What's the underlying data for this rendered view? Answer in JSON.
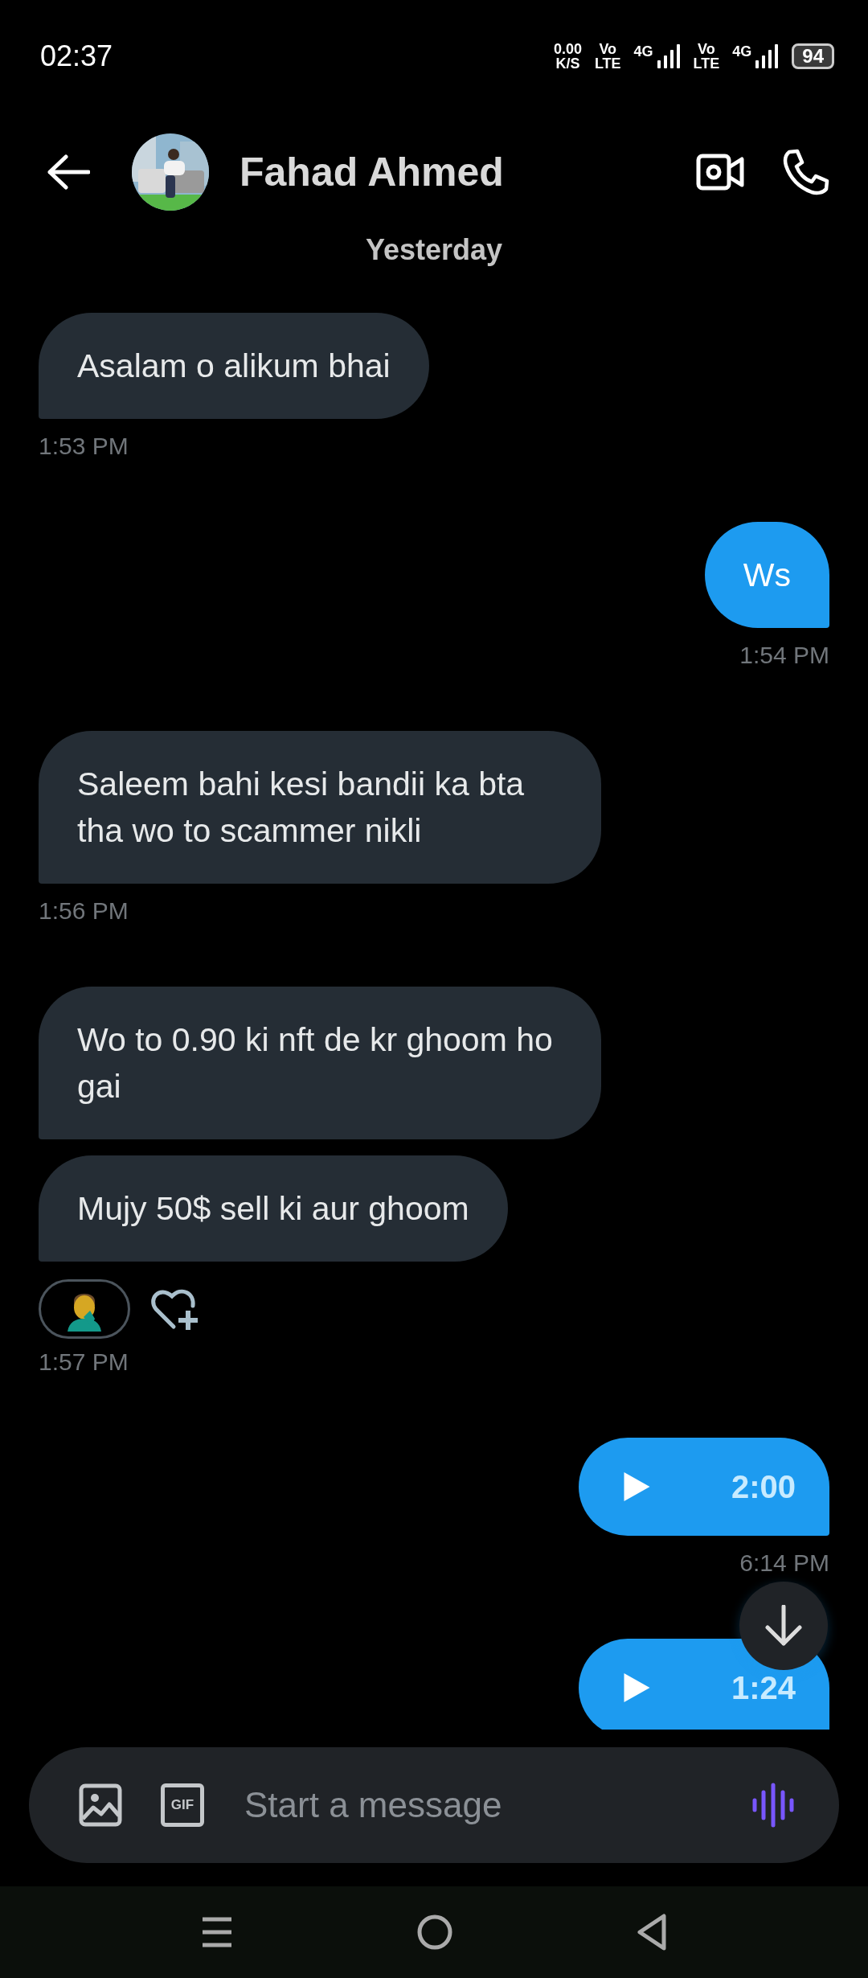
{
  "status_bar": {
    "time": "02:37",
    "net_speed": "0.00",
    "net_unit": "K/S",
    "sims": [
      {
        "vo": "Vo",
        "lte": "LTE",
        "gen": "4G"
      },
      {
        "vo": "Vo",
        "lte": "LTE",
        "gen": "4G"
      }
    ],
    "battery": "94"
  },
  "header": {
    "name": "Fahad Ahmed"
  },
  "day_label": "Yesterday",
  "messages": [
    {
      "kind": "text",
      "outgoing": false,
      "text": "Asalam o alikum bhai"
    },
    {
      "kind": "time",
      "outgoing": false,
      "text": "1:53 PM"
    },
    {
      "kind": "text",
      "outgoing": true,
      "text": "Ws"
    },
    {
      "kind": "time",
      "outgoing": true,
      "text": "1:54 PM"
    },
    {
      "kind": "text",
      "outgoing": false,
      "text": "Saleem bahi kesi bandii ka bta tha wo to scammer nikli"
    },
    {
      "kind": "time",
      "outgoing": false,
      "text": "1:56 PM"
    },
    {
      "kind": "text",
      "outgoing": false,
      "text": "Wo to 0.90 ki nft de kr ghoom ho gai"
    },
    {
      "kind": "text",
      "outgoing": false,
      "text": "Mujy 50$ sell ki aur ghoom"
    },
    {
      "kind": "reactions",
      "outgoing": false
    },
    {
      "kind": "time",
      "outgoing": false,
      "text": "1:57 PM"
    },
    {
      "kind": "voice",
      "outgoing": true,
      "text": "2:00"
    },
    {
      "kind": "time",
      "outgoing": true,
      "text": "6:14 PM"
    },
    {
      "kind": "voice",
      "outgoing": true,
      "text": "1:24"
    }
  ],
  "composer": {
    "gif_label": "GIF",
    "placeholder": "Start a message"
  }
}
